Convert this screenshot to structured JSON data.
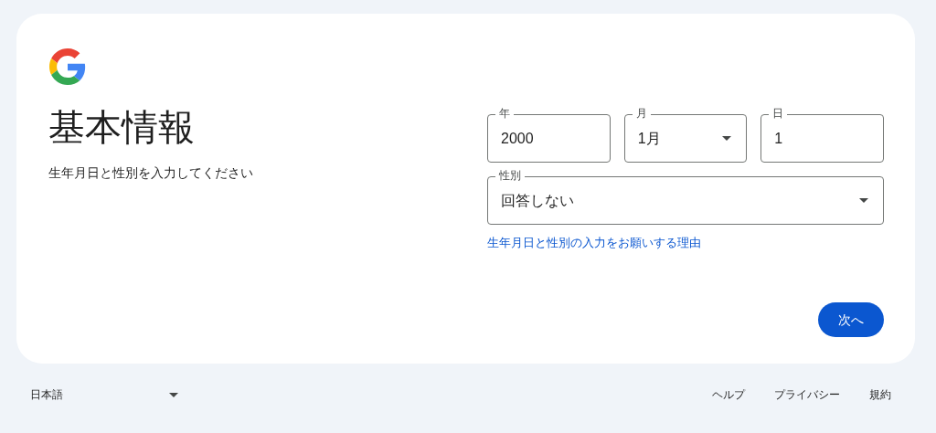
{
  "title": "基本情報",
  "subtitle": "生年月日と性別を入力してください",
  "date_fields": [
    {
      "kind": "text",
      "label": "年",
      "value": "2000"
    },
    {
      "kind": "select",
      "label": "月",
      "value": "1月"
    },
    {
      "kind": "text",
      "label": "日",
      "value": "1"
    }
  ],
  "gender": {
    "kind": "select",
    "label": "性別",
    "value": "回答しない"
  },
  "help_link": "生年月日と性別の入力をお願いする理由",
  "next_button": "次へ",
  "footer": {
    "language": "日本語",
    "links": [
      "ヘルプ",
      "プライバシー",
      "規約"
    ]
  }
}
